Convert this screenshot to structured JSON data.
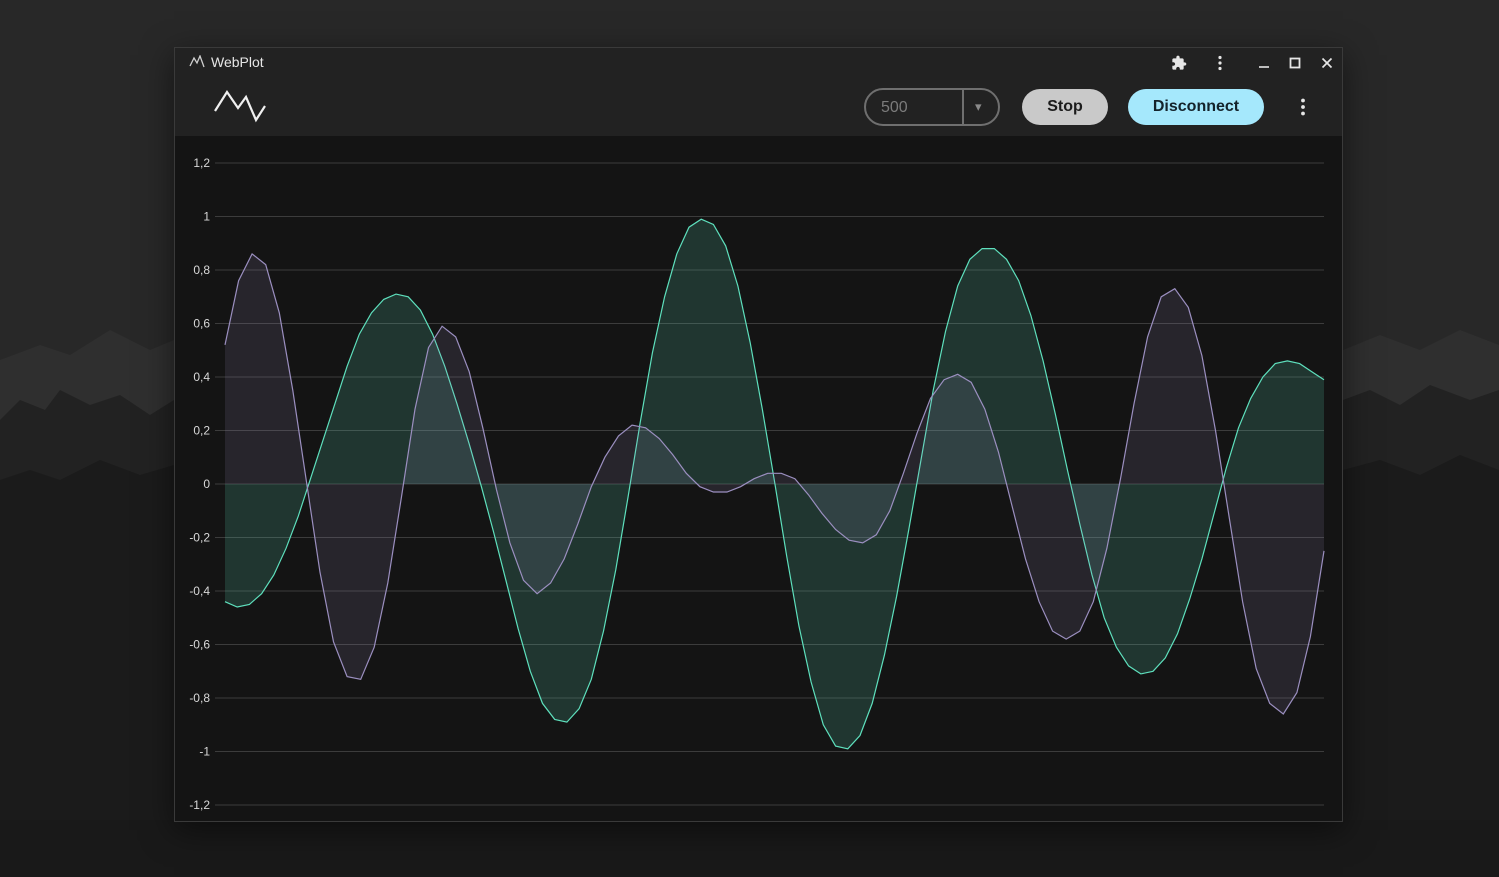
{
  "window": {
    "title": "WebPlot",
    "title_bar_icons": [
      "extensions-icon",
      "kebab-menu-icon",
      "minimize-icon",
      "maximize-icon",
      "close-icon"
    ]
  },
  "toolbar": {
    "logo_icon": "waveform-logo-icon",
    "interval_select": {
      "value": "500",
      "arrow": "▾"
    },
    "stop_label": "Stop",
    "disconnect_label": "Disconnect",
    "menu_icon": "kebab-menu-icon"
  },
  "colors": {
    "series_green": "#5ee0bd",
    "series_purple": "#9b8fc0",
    "disconnect_button": "#a5e8fc",
    "stop_button": "#c9c9c9"
  },
  "chart_data": {
    "type": "area",
    "title": "",
    "xlabel": "",
    "ylabel": "",
    "ylim": [
      -1.2,
      1.2
    ],
    "yticks": [
      "1,2",
      "1",
      "0,8",
      "0,6",
      "0,4",
      "0,2",
      "0",
      "-0,2",
      "-0,4",
      "-0,6",
      "-0,8",
      "-1",
      "-1,2"
    ],
    "grid": true,
    "legend": "none",
    "x": [
      0,
      1,
      2,
      3,
      4,
      5,
      6,
      7,
      8,
      9,
      10,
      11,
      12,
      13,
      14,
      15,
      16,
      17,
      18,
      19,
      20,
      21,
      22,
      23,
      24,
      25,
      26,
      27,
      28,
      29,
      30,
      31,
      32,
      33,
      34,
      35,
      36,
      37,
      38,
      39,
      40,
      41,
      42,
      43,
      44,
      45,
      46,
      47,
      48,
      49,
      50,
      51,
      52,
      53,
      54,
      55,
      56,
      57,
      58,
      59,
      60,
      61,
      62,
      63,
      64,
      65,
      66,
      67,
      68,
      69,
      70,
      71,
      72,
      73,
      74,
      75,
      76,
      77,
      78,
      79,
      80,
      81,
      82,
      83,
      84,
      85,
      86,
      87,
      88,
      89,
      90,
      91,
      92,
      93,
      94,
      95,
      96,
      97,
      98,
      99,
      100,
      101,
      102,
      103,
      104,
      105,
      106,
      107,
      108,
      109,
      110
    ],
    "series": [
      {
        "values": [
          -0.44,
          -0.46,
          -0.45,
          -0.41,
          -0.34,
          -0.24,
          -0.12,
          0.02,
          0.16,
          0.3,
          0.44,
          0.56,
          0.64,
          0.69,
          0.71,
          0.7,
          0.65,
          0.56,
          0.44,
          0.3,
          0.15,
          -0.01,
          -0.18,
          -0.36,
          -0.54,
          -0.7,
          -0.82,
          -0.88,
          -0.89,
          -0.84,
          -0.73,
          -0.55,
          -0.32,
          -0.05,
          0.23,
          0.49,
          0.7,
          0.86,
          0.96,
          0.99,
          0.97,
          0.89,
          0.74,
          0.53,
          0.28,
          0.01,
          -0.27,
          -0.53,
          -0.74,
          -0.9,
          -0.98,
          -0.99,
          -0.94,
          -0.82,
          -0.64,
          -0.42,
          -0.17,
          0.09,
          0.35,
          0.57,
          0.74,
          0.84,
          0.88,
          0.88,
          0.84,
          0.76,
          0.63,
          0.46,
          0.26,
          0.05,
          -0.15,
          -0.34,
          -0.5,
          -0.61,
          -0.68,
          -0.71,
          -0.7,
          -0.65,
          -0.56,
          -0.43,
          -0.28,
          -0.11,
          0.06,
          0.21,
          0.32,
          0.4,
          0.45,
          0.46,
          0.45,
          0.42,
          0.39
        ],
        "color": "#5ee0bd"
      },
      {
        "values": [
          0.52,
          0.76,
          0.86,
          0.82,
          0.64,
          0.35,
          0.01,
          -0.33,
          -0.59,
          -0.72,
          -0.73,
          -0.61,
          -0.37,
          -0.05,
          0.28,
          0.51,
          0.59,
          0.55,
          0.42,
          0.21,
          -0.02,
          -0.22,
          -0.36,
          -0.41,
          -0.37,
          -0.28,
          -0.15,
          -0.01,
          0.1,
          0.18,
          0.22,
          0.21,
          0.17,
          0.11,
          0.04,
          -0.01,
          -0.03,
          -0.03,
          -0.01,
          0.02,
          0.04,
          0.04,
          0.02,
          -0.04,
          -0.11,
          -0.17,
          -0.21,
          -0.22,
          -0.19,
          -0.1,
          0.04,
          0.19,
          0.32,
          0.39,
          0.41,
          0.38,
          0.28,
          0.12,
          -0.08,
          -0.28,
          -0.44,
          -0.55,
          -0.58,
          -0.55,
          -0.44,
          -0.24,
          0.02,
          0.3,
          0.55,
          0.7,
          0.73,
          0.66,
          0.48,
          0.2,
          -0.12,
          -0.44,
          -0.69,
          -0.82,
          -0.86,
          -0.78,
          -0.57,
          -0.25
        ],
        "color": "#9b8fc0"
      }
    ]
  }
}
